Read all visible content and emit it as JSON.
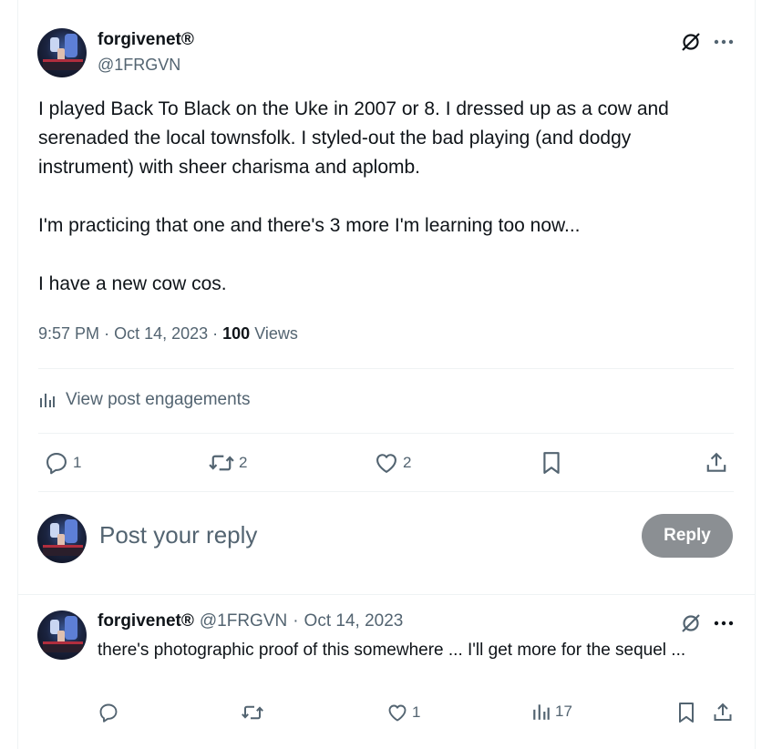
{
  "post": {
    "author_name": "forgivenet®",
    "author_handle": "@1FRGVN",
    "paragraphs": [
      "I played Back To Black on the Uke in 2007 or 8. I dressed up as a cow and serenaded the local townsfolk. I styled-out the bad playing (and dodgy instrument) with sheer charisma and aplomb.",
      "I'm practicing that one and there's 3 more I'm learning too now...",
      "I have a new cow cos."
    ],
    "time": "9:57 PM",
    "date": "Oct 14, 2023",
    "views_count": "100",
    "views_label": "Views",
    "engagements_label": "View post engagements",
    "actions": {
      "replies": "1",
      "reposts": "2",
      "likes": "2"
    }
  },
  "composer": {
    "placeholder": "Post your reply",
    "button_label": "Reply"
  },
  "reply": {
    "author_name": "forgivenet®",
    "author_handle": "@1FRGVN",
    "separator": "·",
    "date": "Oct 14, 2023",
    "text": "there's photographic proof of this somewhere ... I'll get more for the sequel ...",
    "actions": {
      "replies": "",
      "reposts": "",
      "likes": "1",
      "views": "17"
    }
  },
  "icons": {
    "grok": "slashed-circle-icon",
    "more": "more-icon",
    "reply": "reply-icon",
    "repost": "repost-icon",
    "like": "heart-icon",
    "bookmark": "bookmark-icon",
    "share": "share-icon",
    "analytics": "analytics-icon"
  },
  "colors": {
    "text": "#0f1419",
    "secondary": "#536471",
    "border": "#eff3f4",
    "reply_button": "#8b8f93"
  }
}
